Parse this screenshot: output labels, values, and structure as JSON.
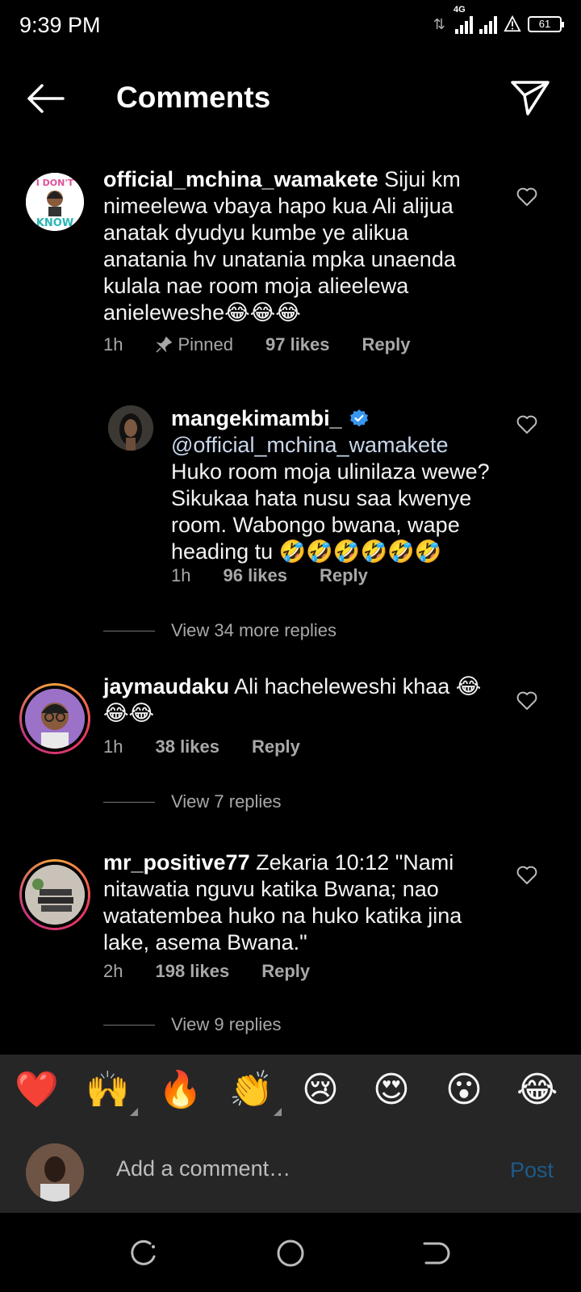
{
  "status_bar": {
    "time": "9:39 PM",
    "network": "4G",
    "battery": "61"
  },
  "header": {
    "title": "Comments"
  },
  "comments": [
    {
      "username": "official_mchina_wamakete",
      "text": "Sijui km nimeelewa vbaya hapo kua Ali alijua anatak dyudyu kumbe ye alikua anatania hv unatania mpka unaenda kulala nae room moja alieelewa anieleweshe😂😂😂",
      "time": "1h",
      "pinned": "Pinned",
      "likes": "97 likes",
      "reply": "Reply"
    },
    {
      "username": "mangekimambi_",
      "mention": "@official_mchina_wamakete",
      "text": "Huko room moja ulinilaza wewe? Sikukaa hata nusu saa kwenye room. Wabongo bwana, wape heading tu 🤣🤣🤣🤣🤣🤣",
      "time": "1h",
      "likes": "96 likes",
      "reply": "Reply",
      "view_replies": "View 34 more replies"
    },
    {
      "username": "jaymaudaku",
      "text": "Ali hacheleweshi khaa 😂😂😂",
      "time": "1h",
      "likes": "38 likes",
      "reply": "Reply",
      "view_replies": "View 7 replies"
    },
    {
      "username": "mr_positive77",
      "text": "Zekaria 10:12 \"Nami nitawatia nguvu katika Bwana; nao watatembea huko na huko katika jina lake, asema Bwana.\"",
      "time": "2h",
      "likes": "198 likes",
      "reply": "Reply",
      "view_replies": "View 9 replies"
    }
  ],
  "reactions": [
    "❤️",
    "🙌",
    "🔥",
    "👏",
    "😢",
    "😍",
    "😮",
    "😂"
  ],
  "composer": {
    "placeholder": "Add a comment…",
    "post_label": "Post"
  },
  "colors": {
    "background": "#000000",
    "panel": "#262626",
    "secondary_text": "#a8a8a8",
    "verified": "#3897f0",
    "post_disabled": "#1c5b8a"
  },
  "icons": [
    "back-arrow-icon",
    "send-icon",
    "heart-icon",
    "pin-icon",
    "verified-badge-icon",
    "recents-icon",
    "home-icon",
    "back-nav-icon"
  ]
}
